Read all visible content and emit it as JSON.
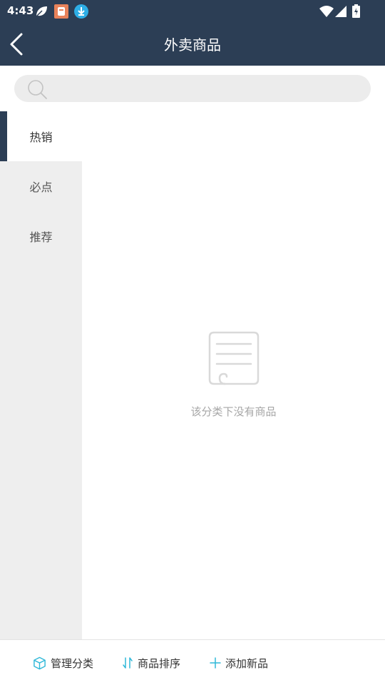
{
  "status_bar": {
    "time": "4:43",
    "icons": [
      "leaf-icon",
      "app-notification-icon",
      "download-icon",
      "wifi-icon",
      "signal-icon",
      "battery-charging-icon"
    ]
  },
  "header": {
    "title": "外卖商品",
    "back_icon": "chevron-left-icon"
  },
  "search": {
    "placeholder": "",
    "value": ""
  },
  "sidebar": {
    "items": [
      {
        "label": "热销",
        "active": true
      },
      {
        "label": "必点",
        "active": false
      },
      {
        "label": "推荐",
        "active": false
      }
    ]
  },
  "main": {
    "empty_icon": "empty-document-icon",
    "empty_text": "该分类下没有商品"
  },
  "bottom_bar": {
    "manage_category": "管理分类",
    "sort_products": "商品排序",
    "add_product": "添加新品"
  },
  "colors": {
    "header_bg": "#2c3e55",
    "accent": "#2fb8d8",
    "sidebar_bg": "#eeeeee"
  }
}
